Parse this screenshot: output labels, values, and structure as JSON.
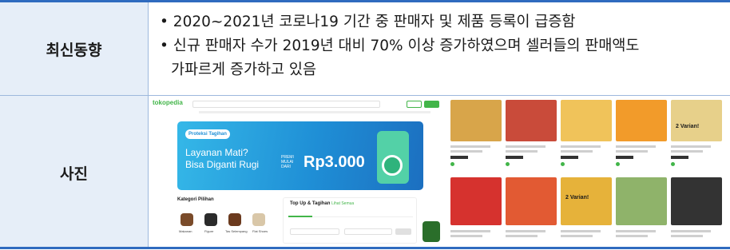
{
  "table": {
    "rows": [
      {
        "label": "최신동향",
        "bullets": [
          {
            "lines": [
              "• 2020~2021년 코로나19 기간 중 판매자 및 제품 등록이 급증함"
            ]
          },
          {
            "lines": [
              "• 신규 판매자 수가 2019년 대비 70% 이상 증가하였으며 셀러들의 판매액도",
              "가파르게 증가하고 있음"
            ]
          }
        ]
      },
      {
        "label": "사진"
      }
    ]
  },
  "screenshot_1": {
    "logo": "tokopedia",
    "banner": {
      "tag": "Proteksi Tagihan",
      "title_lines": [
        "Layanan Mati?",
        "Bisa Diganti Rugi"
      ],
      "premi_lines": [
        "PREMI",
        "MULAI",
        "DARI"
      ],
      "price": "Rp3.000",
      "colors": {
        "start": "#35b8e8",
        "end": "#1c6fc0"
      }
    },
    "category": {
      "title": "Kategori Pilihan",
      "items": [
        "Makanan",
        "Figure",
        "Tas Selempang",
        "Flat Shoes"
      ]
    },
    "topup": {
      "title": "Top Up & Tagihan",
      "link": "Lihat Semua"
    }
  },
  "screenshot_2": {
    "card_colors": [
      "#d8a54a",
      "#c94b3a",
      "#f0c35a",
      "#f29b2a",
      "#e7d08a",
      "#d6322e",
      "#e25a33",
      "#e6b23a",
      "#8fb36a",
      "#333333"
    ],
    "banner_texts": [
      "2 Varian!",
      "2 Varian!"
    ]
  }
}
